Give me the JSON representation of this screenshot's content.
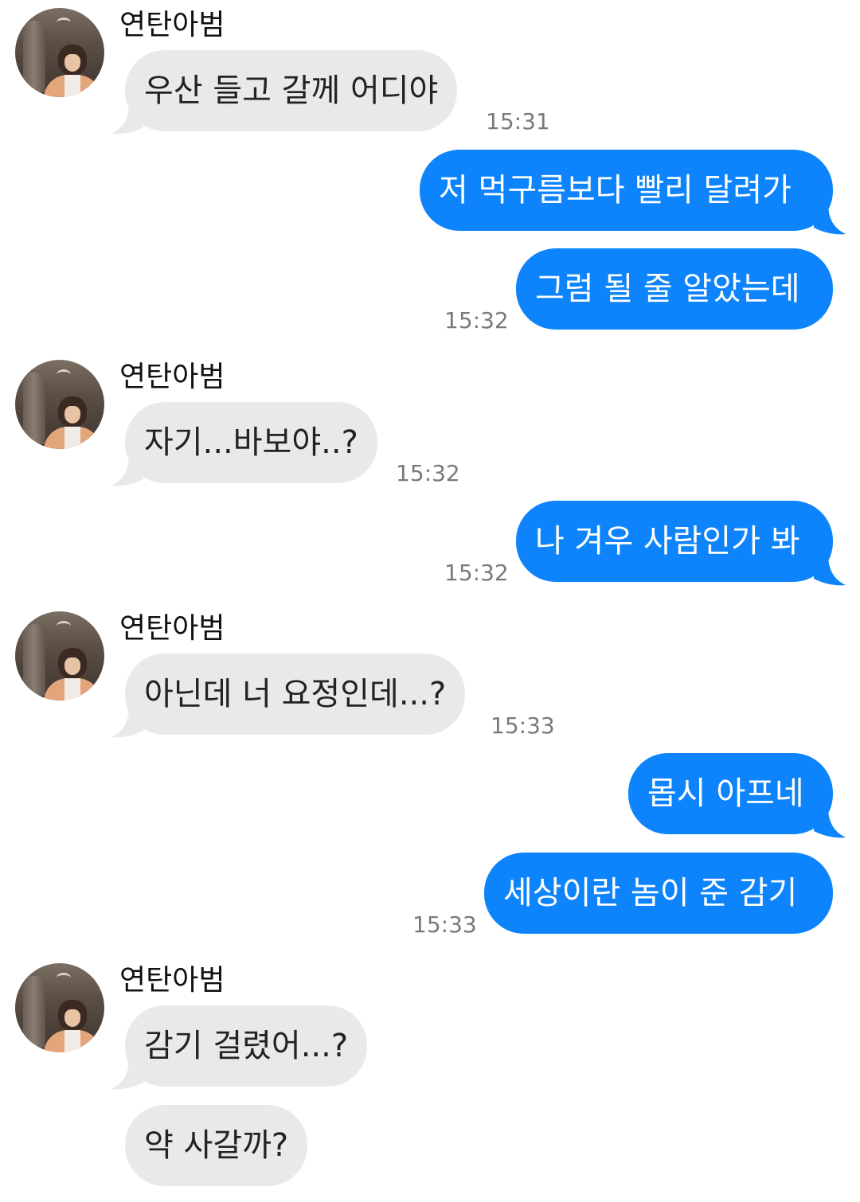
{
  "chat": {
    "contact_name": "연탄아범",
    "colors": {
      "incoming_bubble": "#e9e9ec",
      "outgoing_bubble": "#0d84fb",
      "timestamp": "#7a7a7a"
    },
    "messages": [
      {
        "from": "them",
        "text": "우산 들고 갈께 어디야",
        "time": "15:31"
      },
      {
        "from": "me",
        "text": "저 먹구름보다 빨리 달려가",
        "time": ""
      },
      {
        "from": "me",
        "text": "그럼 될 줄 알았는데",
        "time": "15:32"
      },
      {
        "from": "them",
        "text": "자기...바보야..?",
        "time": "15:32"
      },
      {
        "from": "me",
        "text": "나 겨우 사람인가 봐",
        "time": "15:32"
      },
      {
        "from": "them",
        "text": "아닌데 너 요정인데...?",
        "time": "15:33"
      },
      {
        "from": "me",
        "text": "몹시 아프네",
        "time": ""
      },
      {
        "from": "me",
        "text": "세상이란 놈이 준 감기",
        "time": "15:33"
      },
      {
        "from": "them",
        "text": "감기 걸렸어...?",
        "time": ""
      },
      {
        "from": "them",
        "text": "약 사갈까?",
        "time": ""
      }
    ]
  }
}
